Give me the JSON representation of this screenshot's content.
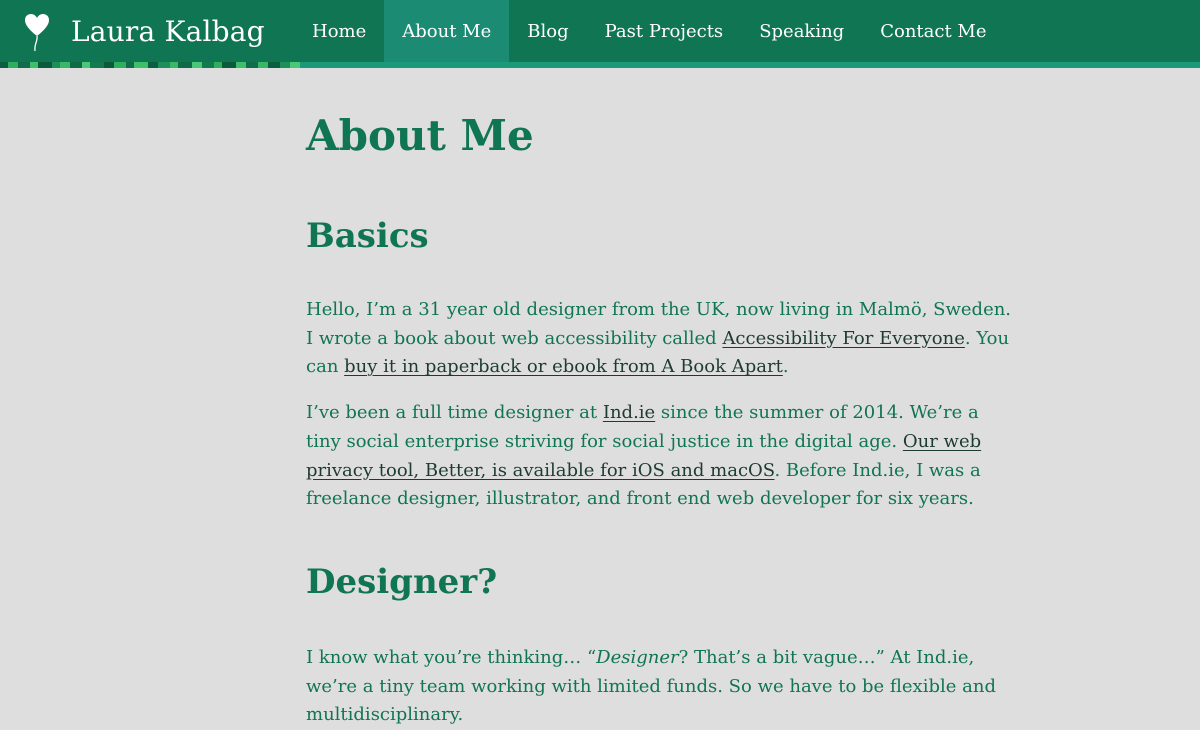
{
  "site": {
    "title": "Laura Kalbag",
    "logo_icon": "heart-balloon-icon"
  },
  "nav": {
    "items": [
      {
        "label": "Home"
      },
      {
        "label": "About Me",
        "active": true
      },
      {
        "label": "Blog"
      },
      {
        "label": "Past Projects"
      },
      {
        "label": "Speaking"
      },
      {
        "label": "Contact Me"
      }
    ]
  },
  "colors": {
    "brand": "#0f7552",
    "nav_active": "#1b8b74",
    "background": "#dedede",
    "link": "#1d3b2f"
  },
  "page": {
    "title": "About Me",
    "sections": {
      "basics": {
        "heading": "Basics",
        "p1": {
          "t1": "Hello, I’m a 31 year old designer from the UK, now living in Malmö, Sweden. I wrote a book about web accessibility called ",
          "link1": "Accessibility For Everyone",
          "t2": ". You can ",
          "link2": "buy it in paperback or ebook from A Book Apart",
          "t3": "."
        },
        "p2": {
          "t1": "I’ve been a full time designer at ",
          "link1": "Ind.ie",
          "t2": " since the summer of 2014. We’re a tiny social enterprise striving for social justice in the digital age. ",
          "link2": "Our web privacy tool, Better, is available for iOS and macOS",
          "t3": ". Before Ind.ie, I was a freelance designer, illustrator, and front end web developer for six years."
        }
      },
      "designer": {
        "heading": "Designer?",
        "p1": {
          "t1": "I know what you’re thinking… “",
          "em": "Designer",
          "t2": "? That’s a bit vague…” At Ind.ie, we’re a tiny team working with limited funds. So we have to be flexible and multidisciplinary."
        }
      }
    }
  }
}
